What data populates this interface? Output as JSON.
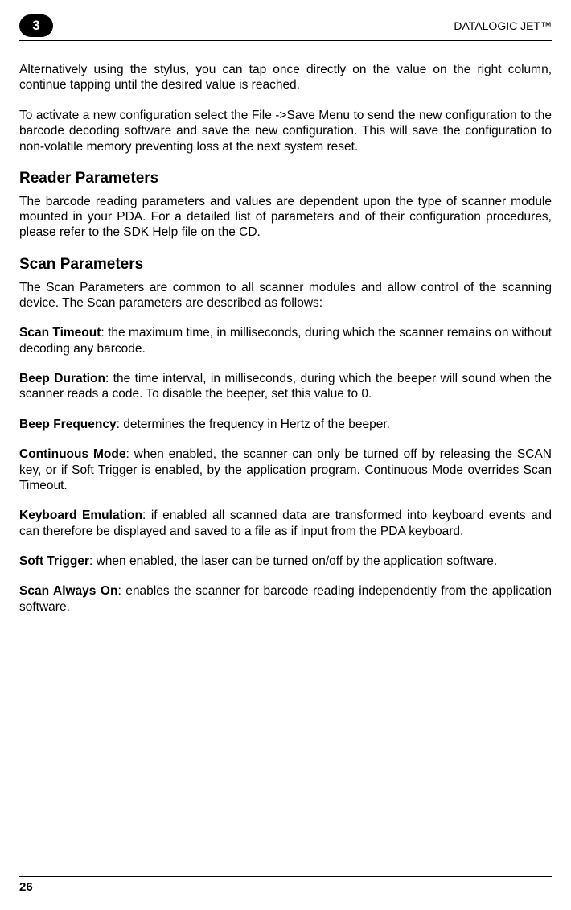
{
  "header": {
    "chapter_number": "3",
    "product_name": "DATALOGIC JET™"
  },
  "body": {
    "para1": "Alternatively using the stylus, you can tap once directly on the value on the right column, continue tapping until the desired value is reached.",
    "para2": "To activate a new configuration select the File ->Save Menu to send the new configuration to the barcode decoding software and save the new configuration. This will save the configuration to non-volatile memory preventing loss at the next system reset.",
    "reader_heading": "Reader Parameters",
    "reader_para": "The barcode reading parameters and values are dependent upon the type of scanner module mounted in your PDA. For a detailed list of parameters and of their configuration procedures, please refer to the SDK Help file on the CD.",
    "scan_heading": "Scan Parameters",
    "scan_intro": "The Scan Parameters are common to all scanner modules and allow control of the scanning device. The Scan parameters are described as follows:",
    "scan_timeout_label": "Scan Timeout",
    "scan_timeout_text": ": the maximum time, in milliseconds, during which the scanner remains on without decoding any barcode.",
    "beep_duration_label": "Beep Duration",
    "beep_duration_text": ": the time interval, in milliseconds, during which the beeper will sound when the scanner reads a code. To disable the beeper, set this value to 0.",
    "beep_frequency_label": "Beep Frequency",
    "beep_frequency_text": ": determines the frequency in Hertz of the beeper.",
    "continuous_mode_label": "Continuous Mode",
    "continuous_mode_text": ": when enabled, the scanner can only be turned off by releasing the SCAN key, or if Soft Trigger is enabled, by the application program. Continuous Mode overrides Scan Timeout.",
    "keyboard_emulation_label": "Keyboard Emulation",
    "keyboard_emulation_text": ": if enabled all scanned data are transformed into keyboard events and can therefore be displayed and saved to a file as if input from the PDA keyboard.",
    "soft_trigger_label": "Soft Trigger",
    "soft_trigger_text": ": when enabled, the laser can be turned on/off by the application software.",
    "scan_always_on_label": "Scan Always On",
    "scan_always_on_text": ": enables the scanner for barcode reading independently from the application software."
  },
  "footer": {
    "page_number": "26"
  }
}
